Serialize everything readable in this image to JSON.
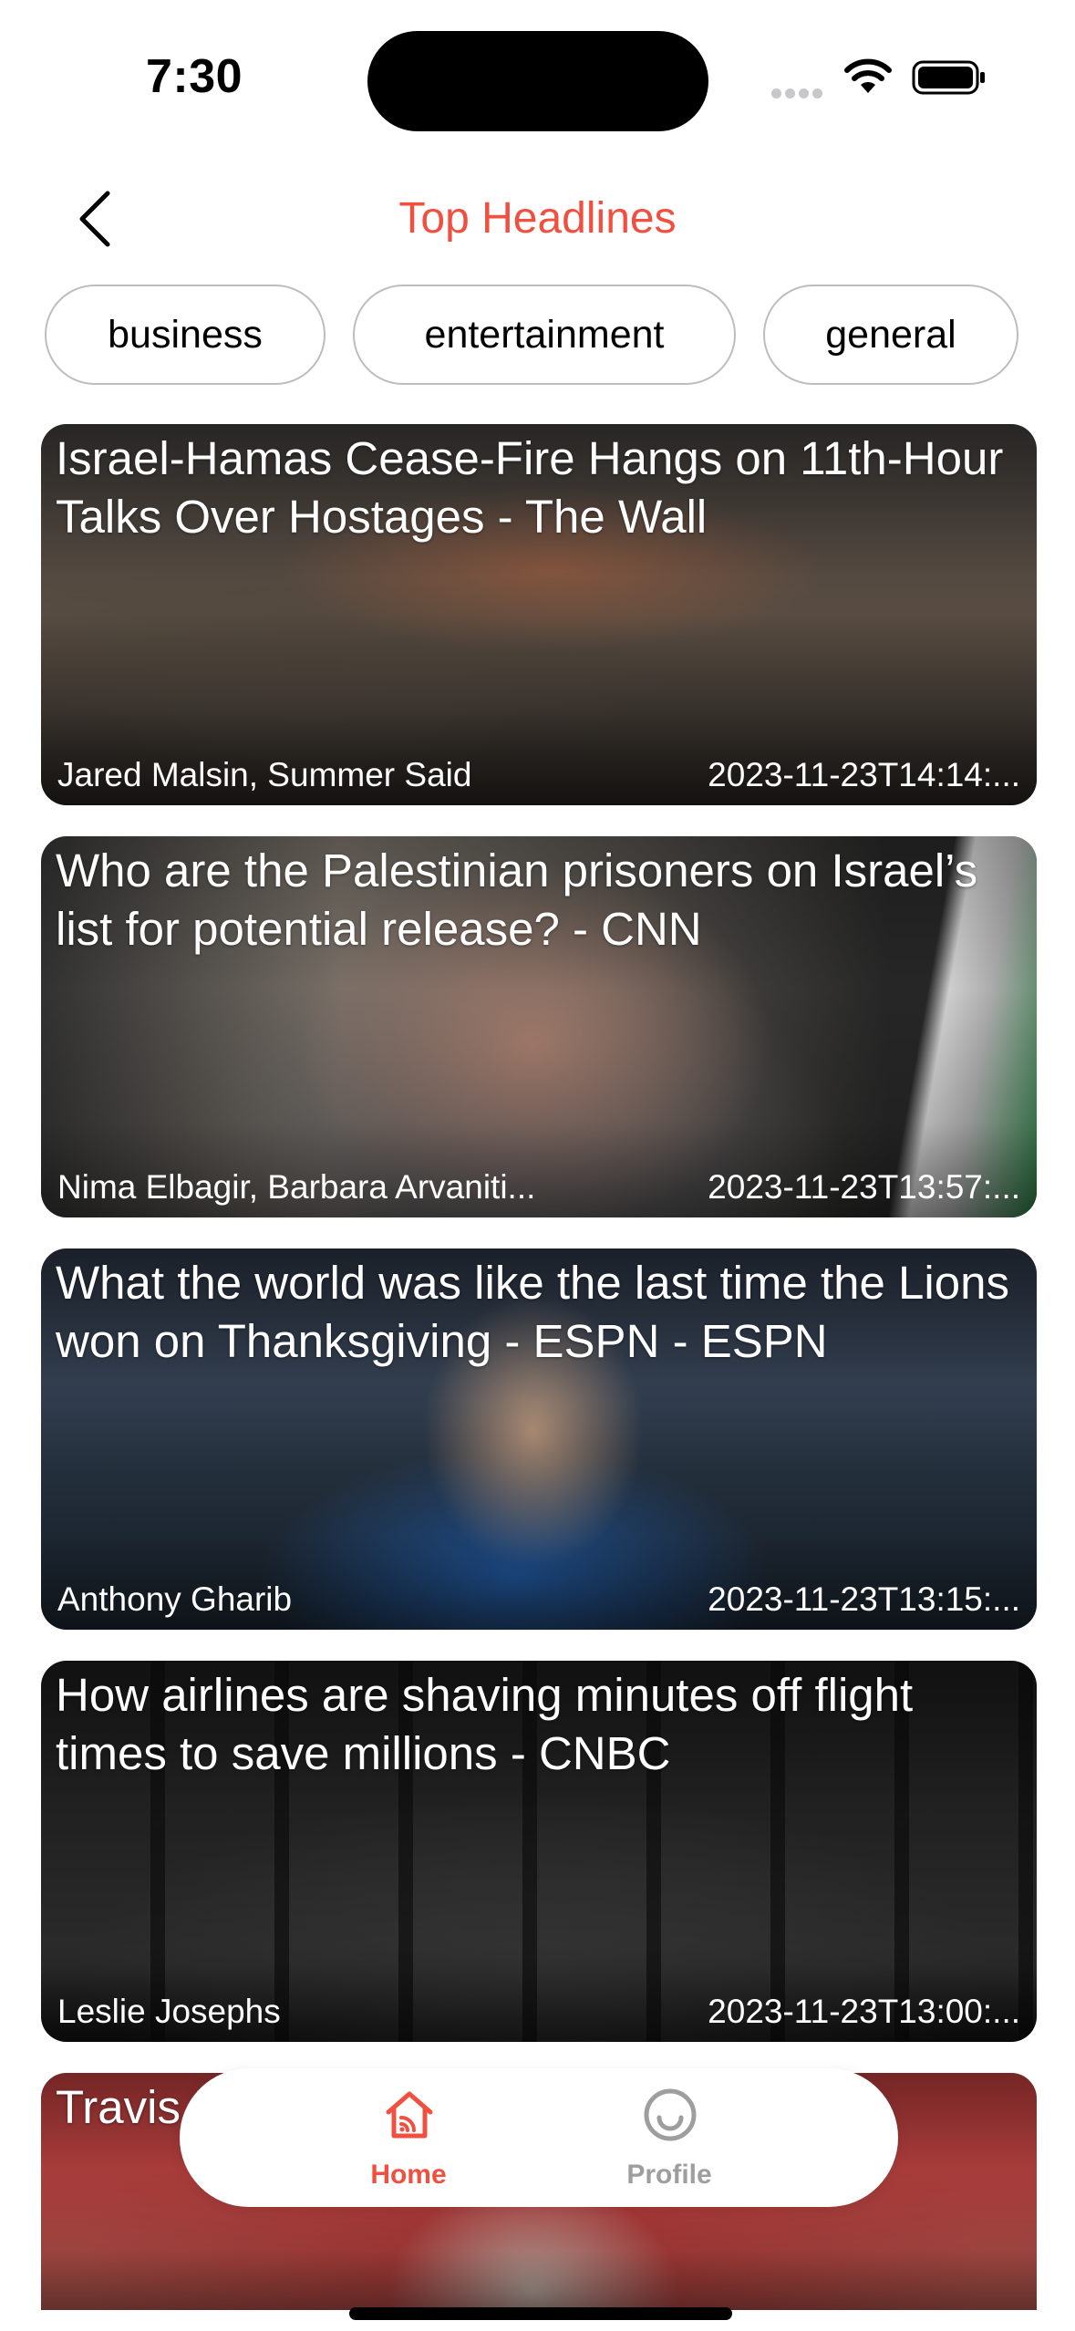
{
  "status_bar": {
    "time": "7:30"
  },
  "nav": {
    "title": "Top Headlines",
    "back_icon": "chevron-left-icon",
    "accent_color": "#ef5040"
  },
  "categories": [
    "business",
    "entertainment",
    "general"
  ],
  "articles": [
    {
      "title": "Israel-Hamas Cease-Fire Hangs on 11th-Hour Talks Over Hostages - The Wall",
      "author": "Jared Malsin, Summer Said",
      "published": "2023-11-23T14:14:..."
    },
    {
      "title": "Who are the Palestinian prisoners on Israel’s list for potential release? - CNN",
      "author": "Nima Elbagir, Barbara Arvaniti...",
      "published": "2023-11-23T13:57:..."
    },
    {
      "title": "What the world was like the last time the Lions won on Thanksgiving - ESPN - ESPN",
      "author": "Anthony Gharib",
      "published": "2023-11-23T13:15:..."
    },
    {
      "title": "How airlines are shaving minutes off flight times to save millions - CNBC",
      "author": "Leslie Josephs",
      "published": "2023-11-23T13:00:..."
    },
    {
      "title": "Travis Kelce on Thanksgiving eating",
      "author": "",
      "published": ""
    }
  ],
  "tabbar": {
    "items": [
      {
        "label": "Home",
        "icon": "home-rss-icon",
        "active": true,
        "color": "#ef5040"
      },
      {
        "label": "Profile",
        "icon": "smiley-face-icon",
        "active": false,
        "color": "#9e9e9e"
      }
    ]
  }
}
